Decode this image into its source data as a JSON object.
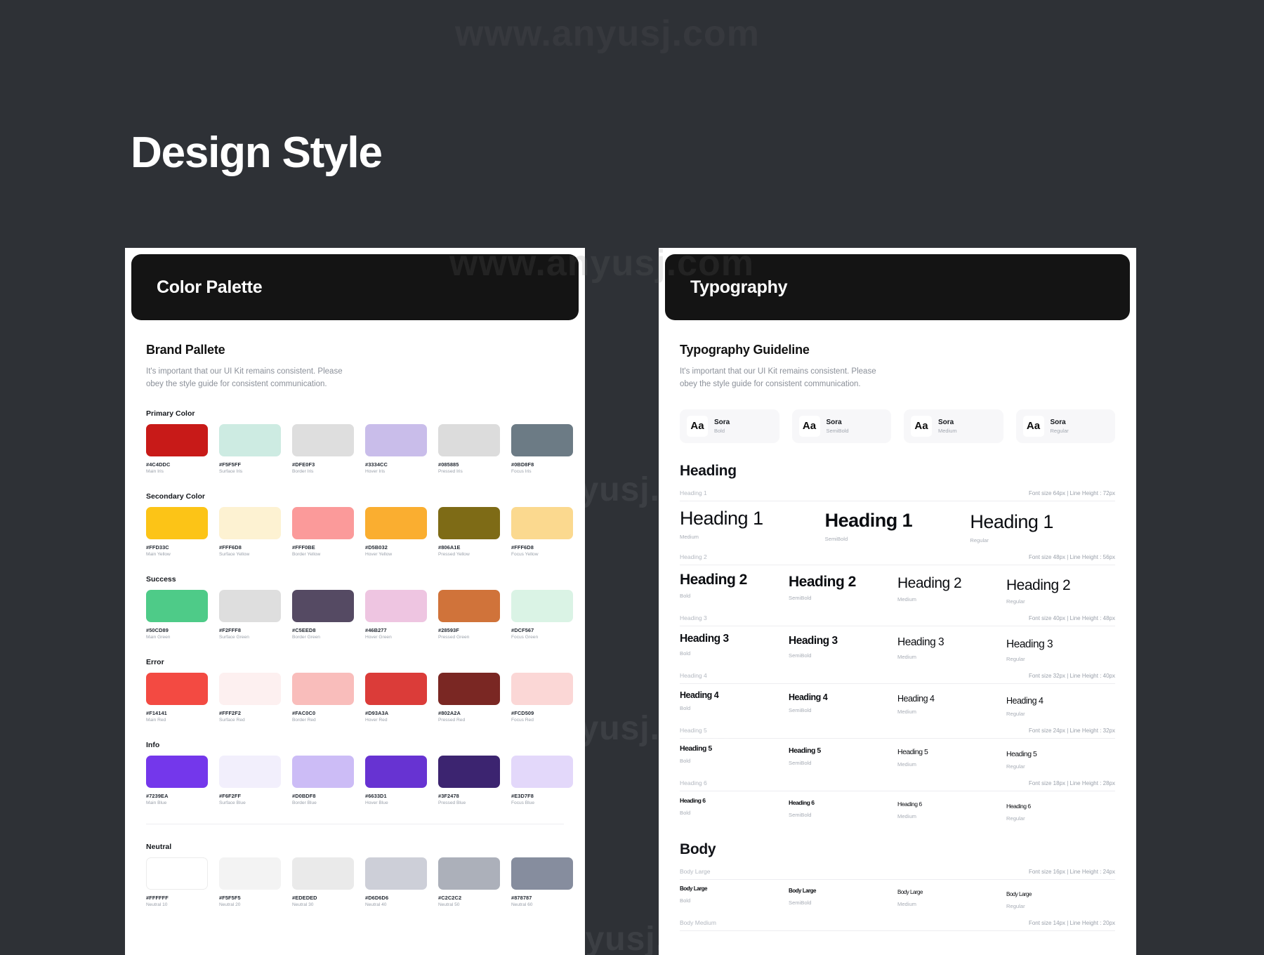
{
  "page": {
    "title": "Design Style",
    "background": "#2e3136",
    "watermark_text": "www.anyusj.com"
  },
  "color_card": {
    "header_title": "Color Palette",
    "section_title": "Brand Pallete",
    "section_desc": "It's important that our UI Kit remains consistent. Please obey the style guide for consistent communication.",
    "groups": [
      {
        "label": "Primary Color",
        "swatches": [
          {
            "hex": "#4C4DDC",
            "name": "Main Iris",
            "display": "#C81A18"
          },
          {
            "hex": "#F5F5FF",
            "name": "Surface Iris",
            "display": "#CDEBE2"
          },
          {
            "hex": "#DFE0F3",
            "name": "Border Iris",
            "display": "#DEDEDE"
          },
          {
            "hex": "#3334CC",
            "name": "Hover Iris",
            "display": "#C9BDEA"
          },
          {
            "hex": "#085885",
            "name": "Pressed Iris",
            "display": "#DCDCDC"
          },
          {
            "hex": "#0BD8F8",
            "name": "Focus Iris",
            "display": "#6C7B85"
          }
        ]
      },
      {
        "label": "Secondary Color",
        "swatches": [
          {
            "hex": "#FFD33C",
            "name": "Main Yellow",
            "display": "#FCC417"
          },
          {
            "hex": "#FFF6D8",
            "name": "Surface Yellow",
            "display": "#FDF2D2"
          },
          {
            "hex": "#FFF0BE",
            "name": "Border Yellow",
            "display": "#FB9A9A"
          },
          {
            "hex": "#D5B032",
            "name": "Hover Yellow",
            "display": "#FAAE30"
          },
          {
            "hex": "#806A1E",
            "name": "Pressed Yellow",
            "display": "#7E6B16"
          },
          {
            "hex": "#FFF6D8",
            "name": "Focus Yellow",
            "display": "#FBD98F"
          }
        ]
      },
      {
        "label": "Success",
        "swatches": [
          {
            "hex": "#50CD89",
            "name": "Main Green",
            "display": "#4ECB88"
          },
          {
            "hex": "#F2FFF8",
            "name": "Surface Green",
            "display": "#DEDEDE"
          },
          {
            "hex": "#C5EED8",
            "name": "Border Green",
            "display": "#554A63"
          },
          {
            "hex": "#46B277",
            "name": "Hover Green",
            "display": "#EEC5E1"
          },
          {
            "hex": "#28593F",
            "name": "Pressed Green",
            "display": "#D0733A"
          },
          {
            "hex": "#DCF567",
            "name": "Focus Green",
            "display": "#DAF3E5"
          }
        ]
      },
      {
        "label": "Error",
        "swatches": [
          {
            "hex": "#F14141",
            "name": "Main Red",
            "display": "#F34A42"
          },
          {
            "hex": "#FFF2F2",
            "name": "Surface Red",
            "display": "#FDF0F0"
          },
          {
            "hex": "#FAC0C0",
            "name": "Border Red",
            "display": "#F9BDBB"
          },
          {
            "hex": "#D93A3A",
            "name": "Hover Red",
            "display": "#DB3C39"
          },
          {
            "hex": "#802A2A",
            "name": "Pressed Red",
            "display": "#7A2723"
          },
          {
            "hex": "#FCD509",
            "name": "Focus Red",
            "display": "#FBD7D6"
          }
        ]
      },
      {
        "label": "Info",
        "swatches": [
          {
            "hex": "#7239EA",
            "name": "Main Blue",
            "display": "#7437EB"
          },
          {
            "hex": "#F6F2FF",
            "name": "Surface Blue",
            "display": "#F2EFFC"
          },
          {
            "hex": "#D0BDF8",
            "name": "Border Blue",
            "display": "#CCBCF6"
          },
          {
            "hex": "#6633D1",
            "name": "Hover Blue",
            "display": "#6733D2"
          },
          {
            "hex": "#3F2478",
            "name": "Pressed Blue",
            "display": "#3C2470"
          },
          {
            "hex": "#E3D7F8",
            "name": "Focus Blue",
            "display": "#E3D8FA"
          }
        ]
      },
      {
        "label": "Neutral",
        "swatches": [
          {
            "hex": "#FFFFFF",
            "name": "Neutral 10",
            "display": "#FFFFFF"
          },
          {
            "hex": "#F5F5F5",
            "name": "Neutral 20",
            "display": "#F3F3F3"
          },
          {
            "hex": "#EDEDED",
            "name": "Neutral 30",
            "display": "#EAEAEA"
          },
          {
            "hex": "#D6D6D6",
            "name": "Neutral 40",
            "display": "#CDCFD8"
          },
          {
            "hex": "#C2C2C2",
            "name": "Neutral 50",
            "display": "#ACB0BA"
          },
          {
            "hex": "#878787",
            "name": "Neutral 60",
            "display": "#868D9E"
          }
        ]
      }
    ]
  },
  "typography_card": {
    "header_title": "Typography",
    "section_title": "Typography Guideline",
    "section_desc": "It's important that our UI Kit remains consistent. Please obey the style guide for consistent communication.",
    "font_cards": [
      {
        "glyph": "Aa",
        "family": "Sora",
        "weight": "Bold"
      },
      {
        "glyph": "Aa",
        "family": "Sora",
        "weight": "SemiBold"
      },
      {
        "glyph": "Aa",
        "family": "Sora",
        "weight": "Medium"
      },
      {
        "glyph": "Aa",
        "family": "Sora",
        "weight": "Regular"
      }
    ],
    "heading_block_title": "Heading",
    "body_block_title": "Body",
    "heading_rows": [
      {
        "label": "Heading 1",
        "metrics": "Font size 64px | Line Height : 72px",
        "samples": [
          {
            "text": "Heading 1",
            "weight": "Medium"
          },
          {
            "text": "Heading 1",
            "weight": "SemiBold"
          },
          {
            "text": "Heading 1",
            "weight": "Regular"
          }
        ]
      },
      {
        "label": "Heading 2",
        "metrics": "Font size 48px | Line Height : 56px",
        "samples": [
          {
            "text": "Heading 2",
            "weight": "Bold"
          },
          {
            "text": "Heading 2",
            "weight": "SemiBold"
          },
          {
            "text": "Heading 2",
            "weight": "Medium"
          },
          {
            "text": "Heading 2",
            "weight": "Regular"
          }
        ]
      },
      {
        "label": "Heading 3",
        "metrics": "Font size 40px | Line Height : 48px",
        "samples": [
          {
            "text": "Heading 3",
            "weight": "Bold"
          },
          {
            "text": "Heading 3",
            "weight": "SemiBold"
          },
          {
            "text": "Heading 3",
            "weight": "Medium"
          },
          {
            "text": "Heading 3",
            "weight": "Regular"
          }
        ]
      },
      {
        "label": "Heading 4",
        "metrics": "Font size 32px | Line Height : 40px",
        "samples": [
          {
            "text": "Heading 4",
            "weight": "Bold"
          },
          {
            "text": "Heading 4",
            "weight": "SemiBold"
          },
          {
            "text": "Heading 4",
            "weight": "Medium"
          },
          {
            "text": "Heading 4",
            "weight": "Regular"
          }
        ]
      },
      {
        "label": "Heading 5",
        "metrics": "Font size 24px | Line Height : 32px",
        "samples": [
          {
            "text": "Heading 5",
            "weight": "Bold"
          },
          {
            "text": "Heading 5",
            "weight": "SemiBold"
          },
          {
            "text": "Heading 5",
            "weight": "Medium"
          },
          {
            "text": "Heading 5",
            "weight": "Regular"
          }
        ]
      },
      {
        "label": "Heading 6",
        "metrics": "Font size 18px | Line Height : 28px",
        "samples": [
          {
            "text": "Heading 6",
            "weight": "Bold"
          },
          {
            "text": "Heading 6",
            "weight": "SemiBold"
          },
          {
            "text": "Heading 6",
            "weight": "Medium"
          },
          {
            "text": "Heading 6",
            "weight": "Regular"
          }
        ]
      }
    ],
    "body_rows": [
      {
        "label": "Body Large",
        "metrics": "Font size 16px | Line Height : 24px",
        "samples": [
          {
            "text": "Body Large",
            "weight": "Bold"
          },
          {
            "text": "Body Large",
            "weight": "SemiBold"
          },
          {
            "text": "Body Large",
            "weight": "Medium"
          },
          {
            "text": "Body Large",
            "weight": "Regular"
          }
        ]
      },
      {
        "label": "Body Medium",
        "metrics": "Font size 14px | Line Height : 20px",
        "samples": []
      }
    ]
  }
}
